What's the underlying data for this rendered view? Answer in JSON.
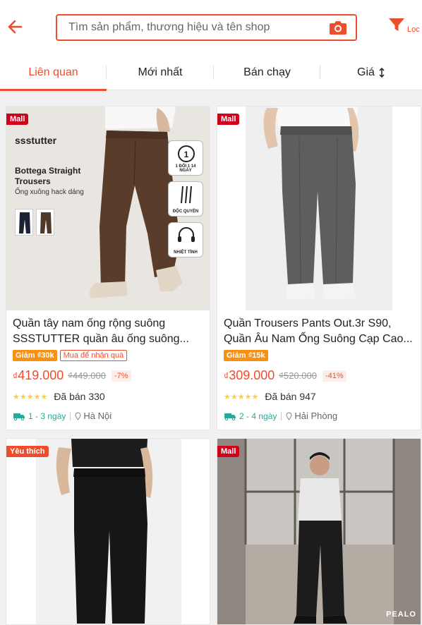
{
  "search": {
    "placeholder": "Tìm sản phẩm, thương hiệu và tên shop",
    "filter_label": "Lọc"
  },
  "tabs": [
    {
      "label": "Liên quan",
      "active": true
    },
    {
      "label": "Mới nhất",
      "active": false
    },
    {
      "label": "Bán chạy",
      "active": false
    },
    {
      "label": "Giá",
      "active": false
    }
  ],
  "colors": {
    "accent": "#ee4d2d",
    "mall_badge": "#d0011b",
    "shipping": "#26aa99",
    "star": "#ffce3d"
  },
  "products": [
    {
      "badge": "Mall",
      "ad": {
        "brand": "ssstutter",
        "title": "Bottega Straight Trousers",
        "subtitle": "Ống xuông hack dáng",
        "features": [
          "1 ĐỔI 1 14 NGÀY",
          "ĐỘC QUYỀN",
          "NHIỆT TÌNH"
        ]
      },
      "title": "Quần tây nam ống rộng suông SSSTUTTER quần âu ống suông...",
      "promos": [
        "Giảm ₫30k",
        "Mua để nhận quà"
      ],
      "price": "419.000",
      "currency": "₫",
      "old_price": "₫449.000",
      "discount": "-7%",
      "rating": 5,
      "sold": "Đã bán 330",
      "ship_time": "1 - 3 ngày",
      "location": "Hà Nội"
    },
    {
      "badge": "Mall",
      "title": "Quần Trousers Pants Out.3r S90, Quần Âu Nam Ống Suông Cạp Cao...",
      "promos": [
        "Giảm ₫15k"
      ],
      "price": "309.000",
      "currency": "₫",
      "old_price": "₫520.000",
      "discount": "-41%",
      "rating": 5,
      "sold": "Đã bán 947",
      "ship_time": "2 - 4 ngày",
      "location": "Hải Phòng"
    },
    {
      "badge": "Yêu thích"
    },
    {
      "badge": "Mall",
      "watermark": "PEALO"
    }
  ]
}
